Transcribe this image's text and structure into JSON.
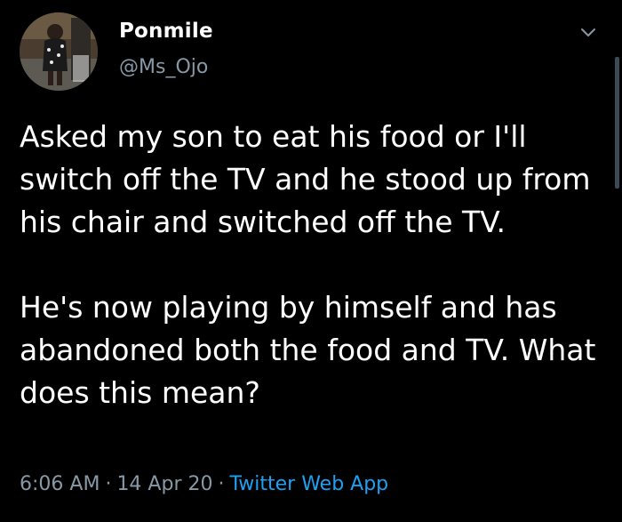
{
  "user": {
    "display_name": "Ponmile",
    "handle": "@Ms_Ojo"
  },
  "tweet": {
    "paragraphs": [
      "Asked my son to eat his food or I'll switch off the TV and he stood up from his chair and switched off the TV.",
      "He's now playing by himself and has abandoned both the food and TV. What does this mean?"
    ]
  },
  "meta": {
    "time": "6:06 AM",
    "separator": "·",
    "date": "14 Apr 20",
    "source": "Twitter Web App"
  },
  "icons": {
    "menu": "chevron-down-icon"
  },
  "colors": {
    "background": "#000000",
    "text": "#ffffff",
    "secondary": "#8899a6",
    "link": "#1da1f2"
  }
}
